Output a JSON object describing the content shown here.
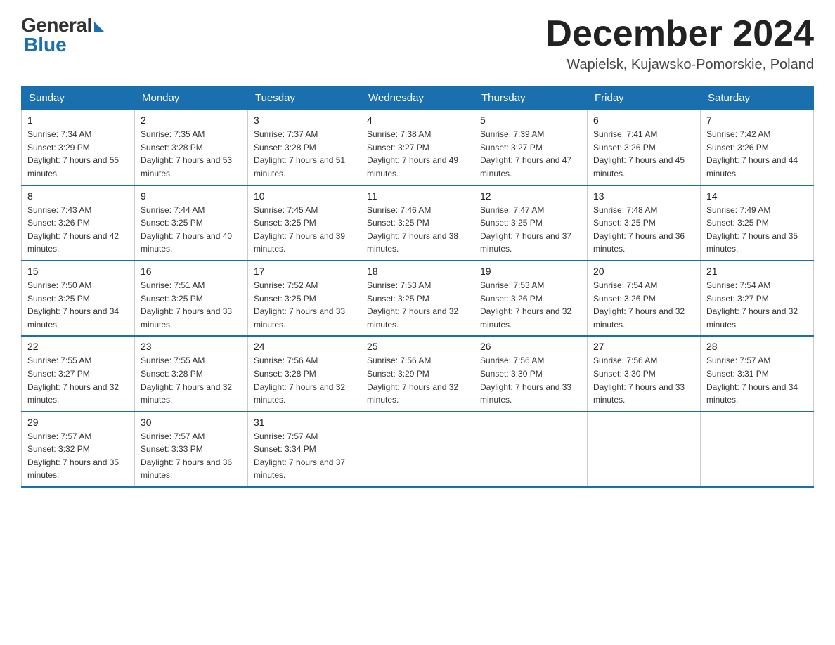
{
  "logo": {
    "general": "General",
    "blue": "Blue"
  },
  "header": {
    "month": "December 2024",
    "location": "Wapielsk, Kujawsko-Pomorskie, Poland"
  },
  "days_of_week": [
    "Sunday",
    "Monday",
    "Tuesday",
    "Wednesday",
    "Thursday",
    "Friday",
    "Saturday"
  ],
  "weeks": [
    [
      {
        "day": "1",
        "sunrise": "7:34 AM",
        "sunset": "3:29 PM",
        "daylight": "7 hours and 55 minutes."
      },
      {
        "day": "2",
        "sunrise": "7:35 AM",
        "sunset": "3:28 PM",
        "daylight": "7 hours and 53 minutes."
      },
      {
        "day": "3",
        "sunrise": "7:37 AM",
        "sunset": "3:28 PM",
        "daylight": "7 hours and 51 minutes."
      },
      {
        "day": "4",
        "sunrise": "7:38 AM",
        "sunset": "3:27 PM",
        "daylight": "7 hours and 49 minutes."
      },
      {
        "day": "5",
        "sunrise": "7:39 AM",
        "sunset": "3:27 PM",
        "daylight": "7 hours and 47 minutes."
      },
      {
        "day": "6",
        "sunrise": "7:41 AM",
        "sunset": "3:26 PM",
        "daylight": "7 hours and 45 minutes."
      },
      {
        "day": "7",
        "sunrise": "7:42 AM",
        "sunset": "3:26 PM",
        "daylight": "7 hours and 44 minutes."
      }
    ],
    [
      {
        "day": "8",
        "sunrise": "7:43 AM",
        "sunset": "3:26 PM",
        "daylight": "7 hours and 42 minutes."
      },
      {
        "day": "9",
        "sunrise": "7:44 AM",
        "sunset": "3:25 PM",
        "daylight": "7 hours and 40 minutes."
      },
      {
        "day": "10",
        "sunrise": "7:45 AM",
        "sunset": "3:25 PM",
        "daylight": "7 hours and 39 minutes."
      },
      {
        "day": "11",
        "sunrise": "7:46 AM",
        "sunset": "3:25 PM",
        "daylight": "7 hours and 38 minutes."
      },
      {
        "day": "12",
        "sunrise": "7:47 AM",
        "sunset": "3:25 PM",
        "daylight": "7 hours and 37 minutes."
      },
      {
        "day": "13",
        "sunrise": "7:48 AM",
        "sunset": "3:25 PM",
        "daylight": "7 hours and 36 minutes."
      },
      {
        "day": "14",
        "sunrise": "7:49 AM",
        "sunset": "3:25 PM",
        "daylight": "7 hours and 35 minutes."
      }
    ],
    [
      {
        "day": "15",
        "sunrise": "7:50 AM",
        "sunset": "3:25 PM",
        "daylight": "7 hours and 34 minutes."
      },
      {
        "day": "16",
        "sunrise": "7:51 AM",
        "sunset": "3:25 PM",
        "daylight": "7 hours and 33 minutes."
      },
      {
        "day": "17",
        "sunrise": "7:52 AM",
        "sunset": "3:25 PM",
        "daylight": "7 hours and 33 minutes."
      },
      {
        "day": "18",
        "sunrise": "7:53 AM",
        "sunset": "3:25 PM",
        "daylight": "7 hours and 32 minutes."
      },
      {
        "day": "19",
        "sunrise": "7:53 AM",
        "sunset": "3:26 PM",
        "daylight": "7 hours and 32 minutes."
      },
      {
        "day": "20",
        "sunrise": "7:54 AM",
        "sunset": "3:26 PM",
        "daylight": "7 hours and 32 minutes."
      },
      {
        "day": "21",
        "sunrise": "7:54 AM",
        "sunset": "3:27 PM",
        "daylight": "7 hours and 32 minutes."
      }
    ],
    [
      {
        "day": "22",
        "sunrise": "7:55 AM",
        "sunset": "3:27 PM",
        "daylight": "7 hours and 32 minutes."
      },
      {
        "day": "23",
        "sunrise": "7:55 AM",
        "sunset": "3:28 PM",
        "daylight": "7 hours and 32 minutes."
      },
      {
        "day": "24",
        "sunrise": "7:56 AM",
        "sunset": "3:28 PM",
        "daylight": "7 hours and 32 minutes."
      },
      {
        "day": "25",
        "sunrise": "7:56 AM",
        "sunset": "3:29 PM",
        "daylight": "7 hours and 32 minutes."
      },
      {
        "day": "26",
        "sunrise": "7:56 AM",
        "sunset": "3:30 PM",
        "daylight": "7 hours and 33 minutes."
      },
      {
        "day": "27",
        "sunrise": "7:56 AM",
        "sunset": "3:30 PM",
        "daylight": "7 hours and 33 minutes."
      },
      {
        "day": "28",
        "sunrise": "7:57 AM",
        "sunset": "3:31 PM",
        "daylight": "7 hours and 34 minutes."
      }
    ],
    [
      {
        "day": "29",
        "sunrise": "7:57 AM",
        "sunset": "3:32 PM",
        "daylight": "7 hours and 35 minutes."
      },
      {
        "day": "30",
        "sunrise": "7:57 AM",
        "sunset": "3:33 PM",
        "daylight": "7 hours and 36 minutes."
      },
      {
        "day": "31",
        "sunrise": "7:57 AM",
        "sunset": "3:34 PM",
        "daylight": "7 hours and 37 minutes."
      },
      null,
      null,
      null,
      null
    ]
  ]
}
